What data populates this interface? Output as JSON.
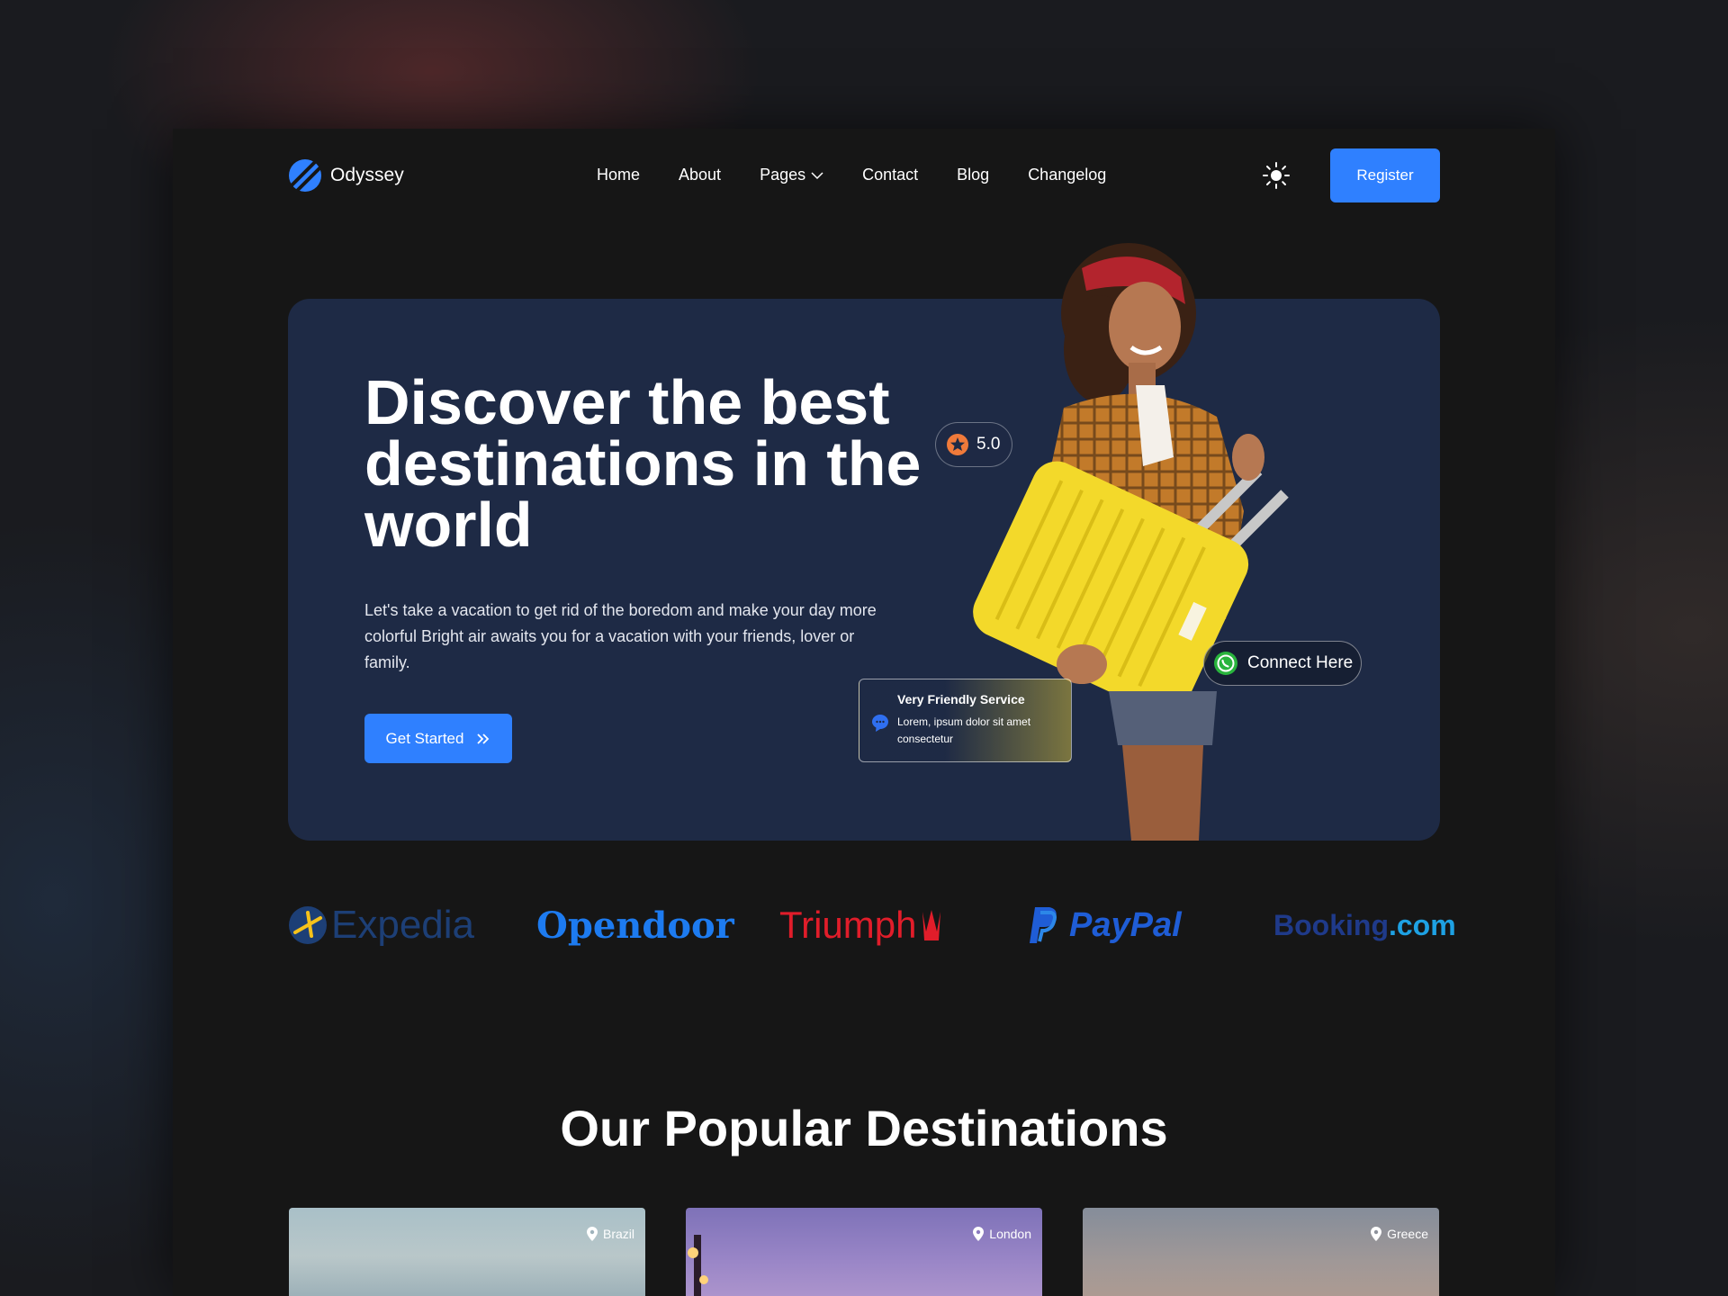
{
  "nav": {
    "brand": "Odyssey",
    "menu": [
      "Home",
      "About",
      "Pages",
      "Contact",
      "Blog",
      "Changelog"
    ],
    "register_label": "Register"
  },
  "hero": {
    "title": "Discover the best destinations in the world",
    "description": "Let's take a vacation to get rid of the boredom and make your day more colorful Bright air awaits you for a vacation with your friends, lover or family.",
    "cta_label": "Get Started",
    "rating": "5.0",
    "connect_label": "Connect Here",
    "service_title": "Very Friendly Service",
    "service_text": "Lorem, ipsum dolor sit amet consectetur"
  },
  "partners": {
    "expedia": "Expedia",
    "opendoor": "Opendoor",
    "triumph": "Triumph",
    "paypal": "PayPal",
    "booking_main": "Booking",
    "booking_suffix": ".com"
  },
  "destinations": {
    "title": "Our Popular Destinations",
    "cards": [
      {
        "location": "Brazil"
      },
      {
        "location": "London"
      },
      {
        "location": "Greece"
      }
    ]
  },
  "colors": {
    "accent": "#2f80ff",
    "hero_bg": "#1e2a45",
    "page_bg": "#161616"
  }
}
